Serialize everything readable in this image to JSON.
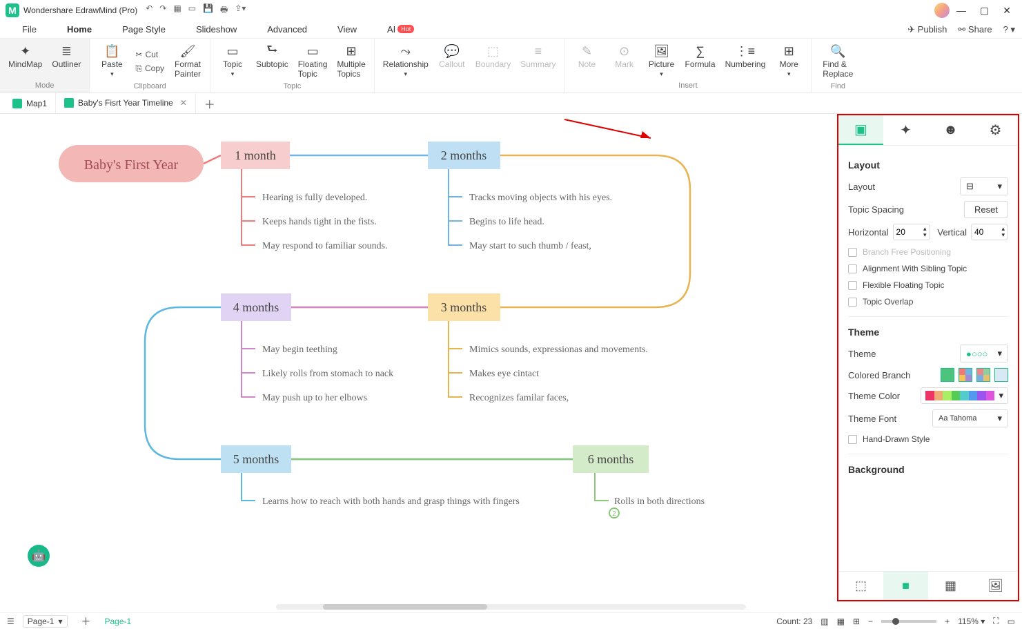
{
  "title": "Wondershare EdrawMind (Pro)",
  "menu": {
    "file": "File",
    "home": "Home",
    "pageStyle": "Page Style",
    "slideshow": "Slideshow",
    "advanced": "Advanced",
    "view": "View",
    "ai": "AI",
    "hot": "Hot",
    "publish": "Publish",
    "share": "Share"
  },
  "ribbon": {
    "mode": {
      "mindmap": "MindMap",
      "outliner": "Outliner",
      "label": "Mode"
    },
    "clipboard": {
      "paste": "Paste",
      "cut": "Cut",
      "copy": "Copy",
      "formatPainter": "Format\nPainter",
      "label": "Clipboard"
    },
    "topic": {
      "topic": "Topic",
      "subtopic": "Subtopic",
      "floating": "Floating\nTopic",
      "multiple": "Multiple\nTopics",
      "label": "Topic"
    },
    "insert": {
      "relationship": "Relationship",
      "callout": "Callout",
      "boundary": "Boundary",
      "summary": "Summary",
      "note": "Note",
      "mark": "Mark",
      "picture": "Picture",
      "formula": "Formula",
      "numbering": "Numbering",
      "more": "More",
      "label": "Insert"
    },
    "find": {
      "findReplace": "Find &\nReplace",
      "label": "Find"
    }
  },
  "docTabs": {
    "map1": "Map1",
    "active": "Baby's Fisrt Year Timeline"
  },
  "mindmap": {
    "title": "Baby's First Year",
    "months": [
      {
        "label": "1 month",
        "color": "#ef7a7a",
        "bg": "#f8cdcd",
        "items": [
          "Hearing is fully developed.",
          "Keeps hands tight in the fists.",
          "May respond to familiar sounds."
        ]
      },
      {
        "label": "2 months",
        "color": "#6fb5e4",
        "bg": "#bfe0f4",
        "items": [
          "Tracks moving objects with his eyes.",
          "Begins to life head.",
          "May start to such thumb / feast,"
        ]
      },
      {
        "label": "3 months",
        "color": "#e8b351",
        "bg": "#fbe1a7",
        "items": [
          "Mimics sounds, expressionas and movements.",
          "Makes eye cintact",
          "Recognizes familar faces,"
        ]
      },
      {
        "label": "4 months",
        "color": "#b293dc",
        "bg": "#e1d3f3",
        "items": [
          "May begin teething",
          "Likely rolls from stomach to nack",
          "May push up to her elbows"
        ]
      },
      {
        "label": "5 months",
        "color": "#54ace0",
        "bg": "#bde1f2",
        "items": [
          "Learns how to reach with both hands and grasp things with fingers"
        ]
      },
      {
        "label": "6 months",
        "color": "#89c979",
        "bg": "#d3ebc9",
        "items": [
          "Rolls in both directions"
        ]
      }
    ]
  },
  "rightPanel": {
    "layoutTitle": "Layout",
    "layoutLabel": "Layout",
    "topicSpacing": "Topic Spacing",
    "reset": "Reset",
    "horizontal": "Horizontal",
    "horizontalVal": "20",
    "vertical": "Vertical",
    "verticalVal": "40",
    "branchFree": "Branch Free Positioning",
    "alignSibling": "Alignment With Sibling Topic",
    "flexFloat": "Flexible Floating Topic",
    "overlap": "Topic Overlap",
    "themeTitle": "Theme",
    "themeLabel": "Theme",
    "coloredBranch": "Colored Branch",
    "themeColor": "Theme Color",
    "themeFont": "Theme Font",
    "themeFontVal": "Tahoma",
    "handDrawn": "Hand-Drawn Style",
    "backgroundTitle": "Background"
  },
  "statusbar": {
    "pageSelect": "Page-1",
    "pageLink": "Page-1",
    "count": "Count: 23",
    "zoom": "115%"
  }
}
